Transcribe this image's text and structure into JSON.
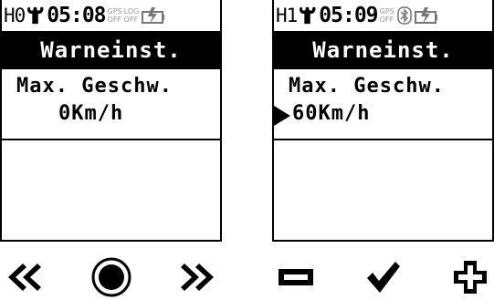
{
  "left_screen": {
    "device_id": "H0",
    "time": "05:08",
    "gps_label": "GPS",
    "gps_state": "OFF",
    "log_label": "LOG",
    "log_state": "OFF",
    "status_icons": [
      "wrench-icon",
      "battery-charging-icon"
    ],
    "title": "Warneinst.",
    "label": "Max. Geschw.",
    "value": "0Km/h",
    "softkeys": [
      "rewind-icon",
      "record-circle-icon",
      "fast-forward-icon"
    ]
  },
  "right_screen": {
    "device_id": "H1",
    "time": "05:09",
    "gps_label": "GPS",
    "gps_state": "OFF",
    "status_icons": [
      "wrench-icon",
      "bluetooth-icon",
      "battery-charging-icon"
    ],
    "title": "Warneinst.",
    "label": "Max. Geschw.",
    "value": "60Km/h",
    "selection_cursor": "triangle-pointer-icon",
    "softkeys": [
      "minus-icon",
      "checkmark-icon",
      "plus-icon"
    ]
  }
}
